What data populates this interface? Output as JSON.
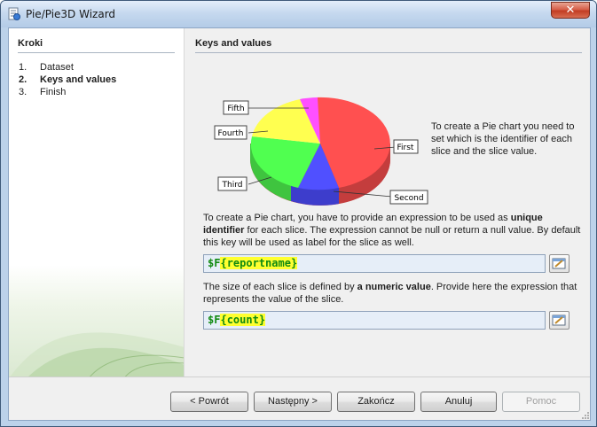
{
  "window": {
    "title": "Pie/Pie3D Wizard",
    "close_label": "✕"
  },
  "steps": {
    "title": "Kroki",
    "items": [
      {
        "num": "1.",
        "label": "Dataset",
        "active": false
      },
      {
        "num": "2.",
        "label": "Keys and values",
        "active": true
      },
      {
        "num": "3.",
        "label": "Finish",
        "active": false
      }
    ]
  },
  "content": {
    "title": "Keys and values",
    "chart_callout": "To create a Pie chart you need to set which is the identifier of each slice and the slice value.",
    "para1": {
      "pre": "To create a Pie chart, you have to provide an expression to be used as ",
      "bold": "unique identifier",
      "post": " for each slice. The expression cannot be null or return a null value. By default this key will be used as label for the slice as well."
    },
    "key_expression": {
      "prefix": "$F",
      "open": "{",
      "field": "reportname",
      "close": "}"
    },
    "para2": {
      "pre": "The size of each slice is defined by ",
      "bold": "a numeric value",
      "post": ". Provide here the expression that represents the value of the slice."
    },
    "value_expression": {
      "prefix": "$F",
      "open": "{",
      "field": "count",
      "close": "}"
    }
  },
  "chart_data": {
    "type": "pie",
    "categories": [
      "First",
      "Second",
      "Third",
      "Fourth",
      "Fifth"
    ],
    "colors": [
      "#ff5050",
      "#5050ff",
      "#50ff50",
      "#ffff50",
      "#ff50ff"
    ]
  },
  "buttons": {
    "back": "< Powrót",
    "next": "Następny >",
    "finish": "Zakończ",
    "cancel": "Anuluj",
    "help": "Pomoc"
  }
}
